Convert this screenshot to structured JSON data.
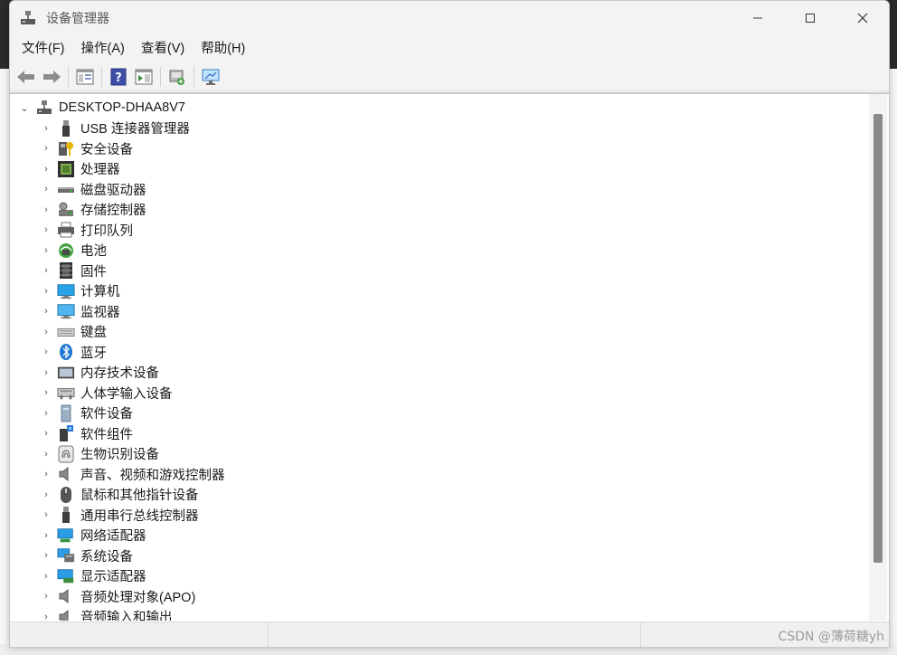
{
  "window": {
    "title": "设备管理器",
    "controls": {
      "minimize": "—",
      "maximize": "☐",
      "close": "✕"
    }
  },
  "menu": {
    "items": [
      "文件(F)",
      "操作(A)",
      "查看(V)",
      "帮助(H)"
    ]
  },
  "toolbar": {
    "buttons": [
      "back-arrow-icon",
      "forward-arrow-icon",
      "show-hide-console-tree-icon",
      "help-icon",
      "properties-icon",
      "scan-hardware-icon",
      "monitor-icon"
    ]
  },
  "tree": {
    "root_label": "DESKTOP-DHAA8V7",
    "root_chevron": "⌄",
    "child_chevron": "›",
    "items": [
      {
        "label": "USB 连接器管理器",
        "icon": "usb-icon"
      },
      {
        "label": "安全设备",
        "icon": "security-key-icon"
      },
      {
        "label": "处理器",
        "icon": "processor-icon"
      },
      {
        "label": "磁盘驱动器",
        "icon": "disk-drive-icon"
      },
      {
        "label": "存储控制器",
        "icon": "storage-controller-icon"
      },
      {
        "label": "打印队列",
        "icon": "printer-icon"
      },
      {
        "label": "电池",
        "icon": "battery-icon"
      },
      {
        "label": "固件",
        "icon": "firmware-icon"
      },
      {
        "label": "计算机",
        "icon": "computer-icon"
      },
      {
        "label": "监视器",
        "icon": "monitor-icon"
      },
      {
        "label": "键盘",
        "icon": "keyboard-icon"
      },
      {
        "label": "蓝牙",
        "icon": "bluetooth-icon"
      },
      {
        "label": "内存技术设备",
        "icon": "memory-device-icon"
      },
      {
        "label": "人体学输入设备",
        "icon": "hid-icon"
      },
      {
        "label": "软件设备",
        "icon": "software-device-icon"
      },
      {
        "label": "软件组件",
        "icon": "software-component-icon"
      },
      {
        "label": "生物识别设备",
        "icon": "fingerprint-icon"
      },
      {
        "label": "声音、视频和游戏控制器",
        "icon": "speaker-icon"
      },
      {
        "label": "鼠标和其他指针设备",
        "icon": "mouse-icon"
      },
      {
        "label": "通用串行总线控制器",
        "icon": "usb-controller-icon"
      },
      {
        "label": "网络适配器",
        "icon": "network-adapter-icon"
      },
      {
        "label": "系统设备",
        "icon": "system-device-icon"
      },
      {
        "label": "显示适配器",
        "icon": "display-adapter-icon"
      },
      {
        "label": "音频处理对象(APO)",
        "icon": "audio-apo-icon"
      },
      {
        "label": "音频输入和输出",
        "icon": "audio-io-icon"
      }
    ]
  },
  "watermark": "CSDN @薄荷糖yh"
}
